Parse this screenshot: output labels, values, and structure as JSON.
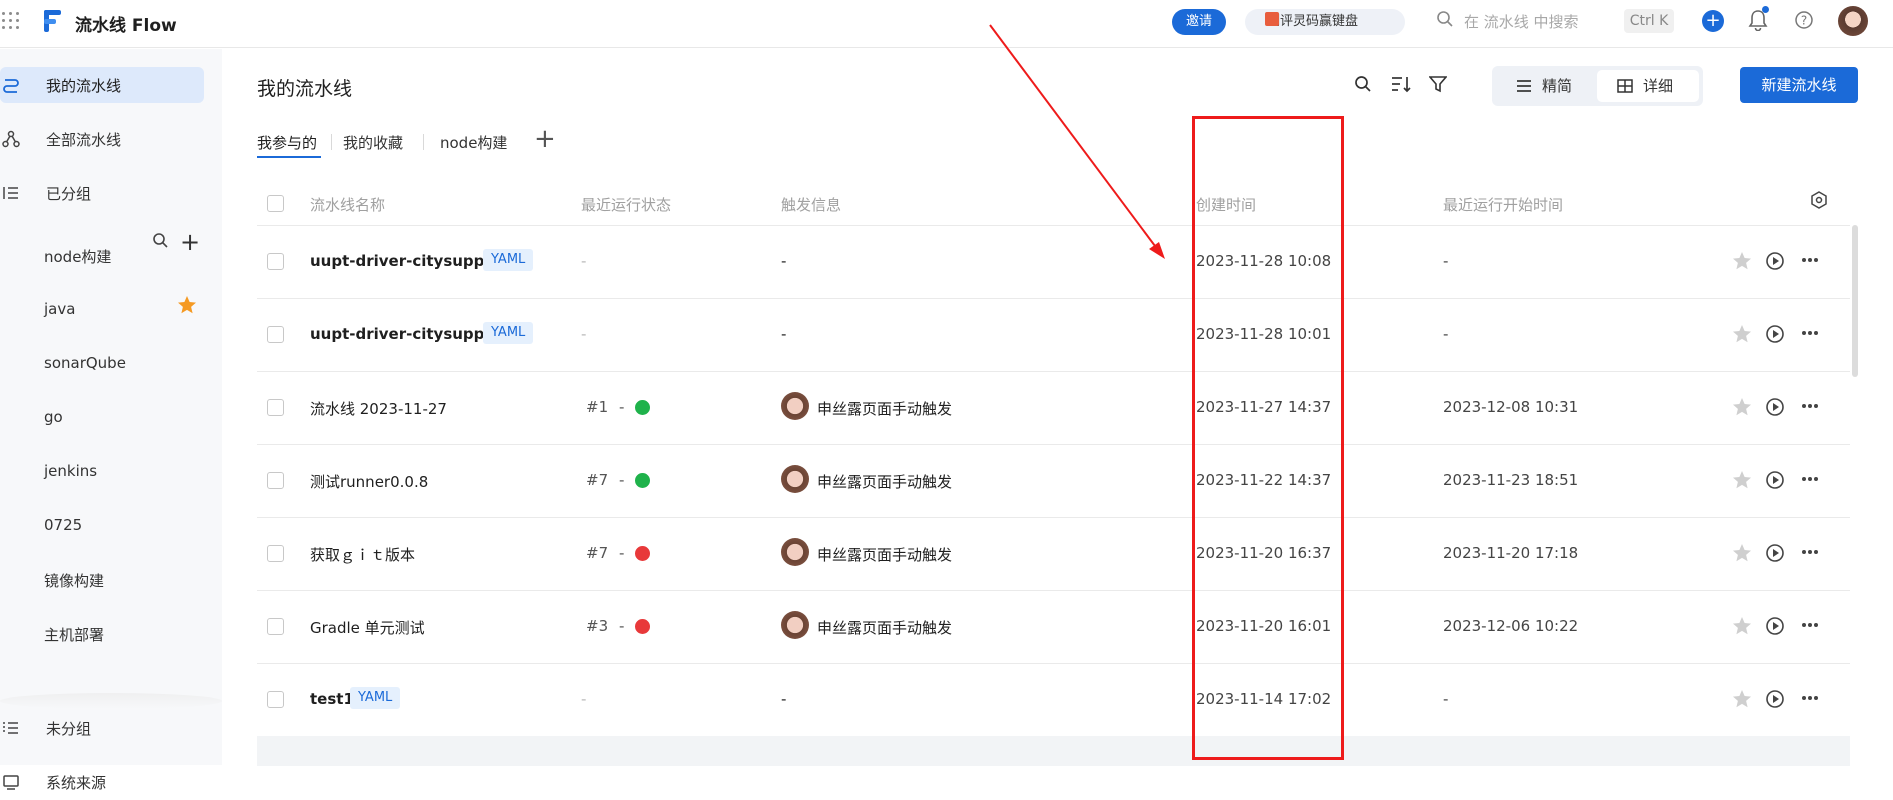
{
  "topbar": {
    "app_title": "流水线 Flow",
    "invite_label": "邀请",
    "promo_label": "测评灵码赢键盘",
    "search_placeholder": "在 流水线 中搜索",
    "shortcut": "Ctrl K"
  },
  "sidebar": {
    "items": [
      {
        "label": "我的流水线",
        "icon": "pipeline-icon",
        "active": true
      },
      {
        "label": "全部流水线",
        "icon": "network-icon",
        "active": false
      },
      {
        "label": "已分组",
        "icon": "group-list-icon",
        "active": false
      }
    ],
    "groups": [
      "node构建",
      "java",
      "sonarQube",
      "go",
      "jenkins",
      "0725",
      "镜像构建",
      "主机部署"
    ],
    "ungrouped_label": "未分组",
    "system_source_label": "系统来源"
  },
  "main": {
    "title": "我的流水线",
    "view_simple": "精简",
    "view_detail": "详细",
    "new_button": "新建流水线",
    "tabs": [
      "我参与的",
      "我的收藏",
      "node构建"
    ],
    "columns": {
      "name": "流水线名称",
      "status": "最近运行状态",
      "trigger": "触发信息",
      "created": "创建时间",
      "last_run": "最近运行开始时间"
    },
    "rows": [
      {
        "name": "uupt-driver-citysupp...",
        "yaml": "YAML",
        "status": "-",
        "trigger": "-",
        "created": "2023-11-28 10:08",
        "last_run": "-"
      },
      {
        "name": "uupt-driver-citysupp...",
        "yaml": "YAML",
        "status": "-",
        "trigger": "-",
        "created": "2023-11-28 10:01",
        "last_run": "-"
      },
      {
        "name": "流水线 2023-11-27",
        "yaml": "",
        "status": "#1",
        "result": "success",
        "trigger": "申丝露页面手动触发",
        "created": "2023-11-27 14:37",
        "last_run": "2023-12-08 10:31"
      },
      {
        "name": "测试runner0.0.8",
        "yaml": "",
        "status": "#7",
        "result": "success",
        "trigger": "申丝露页面手动触发",
        "created": "2023-11-22 14:37",
        "last_run": "2023-11-23 18:51"
      },
      {
        "name": "获取ｇｉｔ版本",
        "yaml": "",
        "status": "#7",
        "result": "failure",
        "trigger": "申丝露页面手动触发",
        "created": "2023-11-20 16:37",
        "last_run": "2023-11-20 17:18"
      },
      {
        "name": "Gradle 单元测试",
        "yaml": "",
        "status": "#3",
        "result": "failure",
        "trigger": "申丝露页面手动触发",
        "created": "2023-11-20 16:01",
        "last_run": "2023-12-06 10:22"
      },
      {
        "name": "test1",
        "yaml": "YAML",
        "status": "-",
        "trigger": "-",
        "created": "2023-11-14 17:02",
        "last_run": "-"
      }
    ]
  },
  "colors": {
    "primary": "#1b6ad8",
    "success": "#1fb24b",
    "failure": "#e8393a",
    "annotation": "#ee1b1b",
    "favorite": "#f59a23"
  }
}
